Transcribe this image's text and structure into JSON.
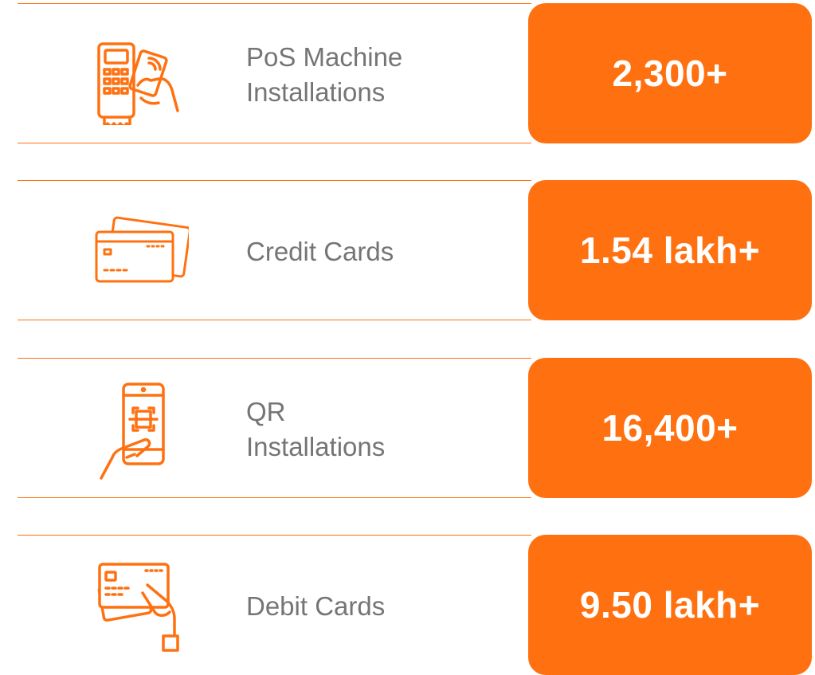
{
  "stats": [
    {
      "label_line1": "PoS Machine",
      "label_line2": "Installations",
      "value": "2,300+",
      "icon": "pos-machine-icon"
    },
    {
      "label_line1": "Credit Cards",
      "label_line2": "",
      "value": "1.54 lakh+",
      "icon": "credit-cards-icon"
    },
    {
      "label_line1": "QR",
      "label_line2": "Installations",
      "value": "16,400+",
      "icon": "qr-phone-icon"
    },
    {
      "label_line1": "Debit Cards",
      "label_line2": "",
      "value": "9.50 lakh+",
      "icon": "debit-card-hand-icon"
    }
  ],
  "colors": {
    "accent": "#ff7110",
    "text": "#757575",
    "value_text": "#ffffff"
  }
}
